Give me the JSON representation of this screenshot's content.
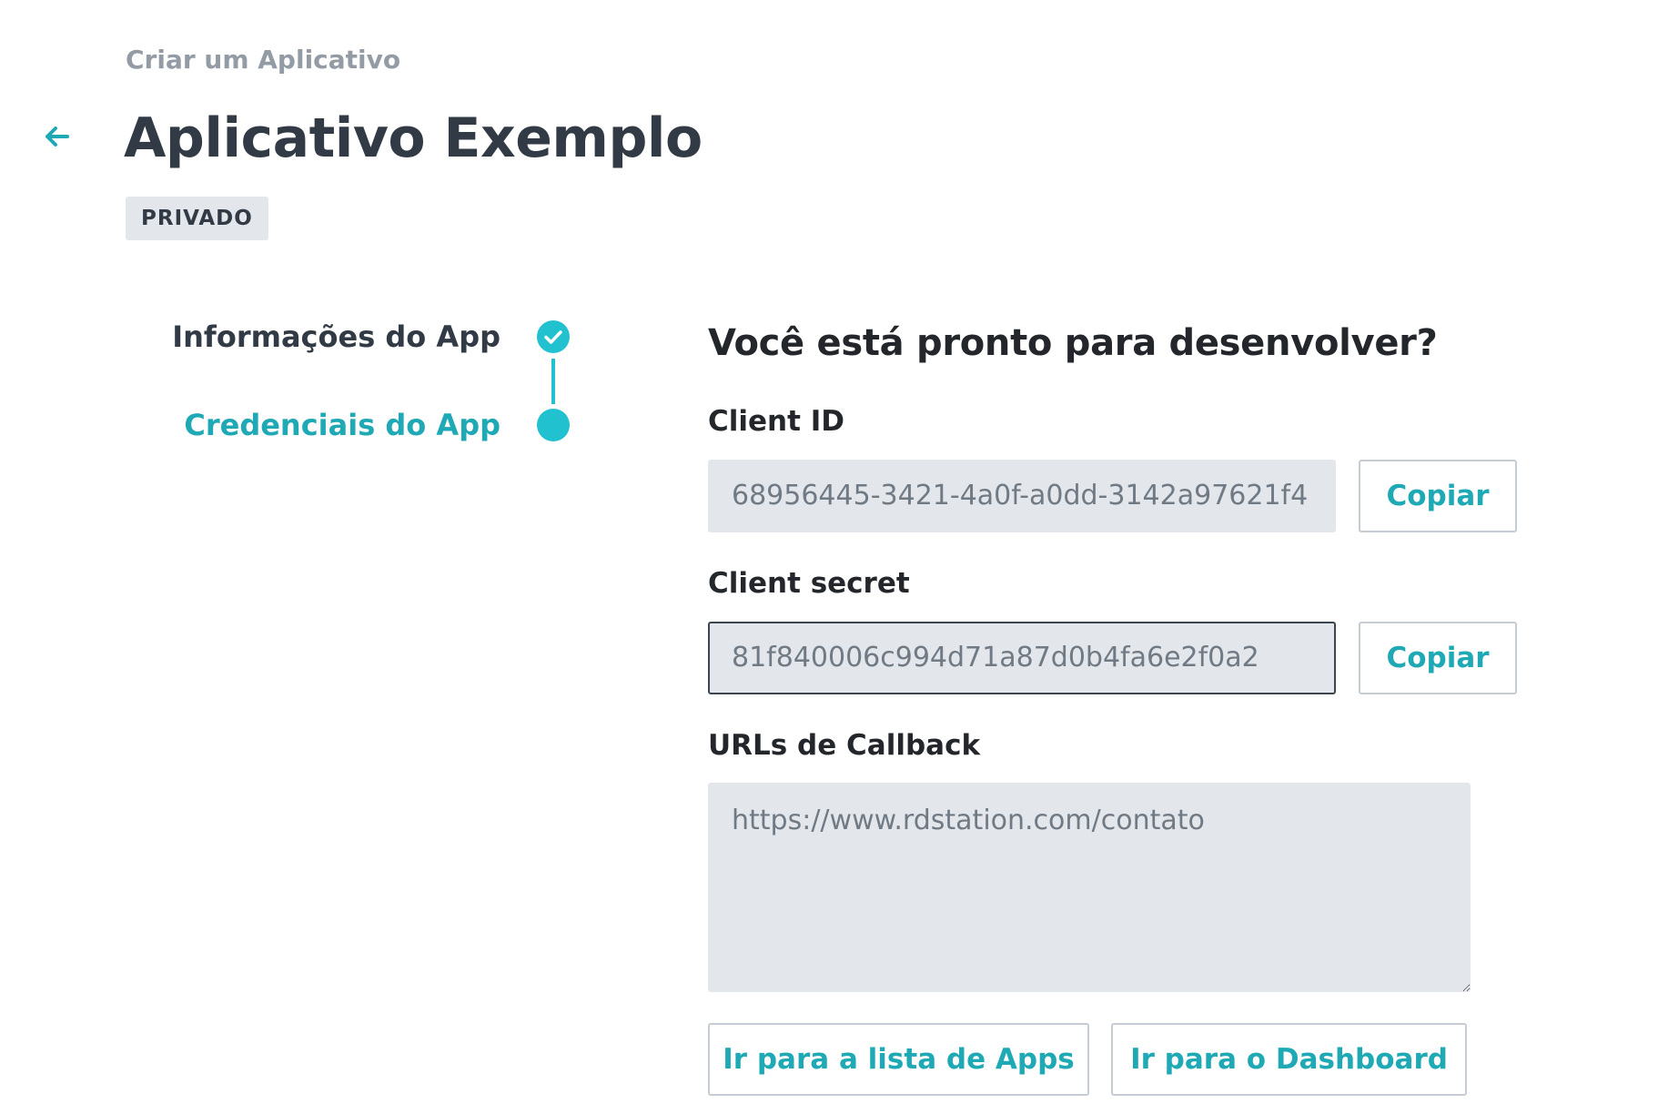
{
  "header": {
    "breadcrumb": "Criar um Aplicativo",
    "title": "Aplicativo Exemplo",
    "badge": "PRIVADO"
  },
  "steps": [
    {
      "label": "Informações do App",
      "status": "done"
    },
    {
      "label": "Credenciais do App",
      "status": "active"
    }
  ],
  "main": {
    "heading": "Você está pronto para desenvolver?",
    "client_id": {
      "label": "Client ID",
      "value": "68956445-3421-4a0f-a0dd-3142a97621f4",
      "copy_label": "Copiar"
    },
    "client_secret": {
      "label": "Client secret",
      "value": "81f840006c994d71a87d0b4fa6e2f0a2",
      "copy_label": "Copiar"
    },
    "callback": {
      "label": "URLs de Callback",
      "value": "https://www.rdstation.com/contato"
    },
    "actions": {
      "apps_list": "Ir para a lista de Apps",
      "dashboard": "Ir para o Dashboard"
    }
  },
  "colors": {
    "accent": "#1fa9b5",
    "step_accent": "#21c1cf",
    "text_dark": "#323b45",
    "muted": "#939ba4",
    "field_bg": "#e3e6ea"
  },
  "icons": {
    "back": "arrow-left-icon",
    "step_done": "check-circle-icon",
    "step_active": "filled-circle-icon"
  }
}
